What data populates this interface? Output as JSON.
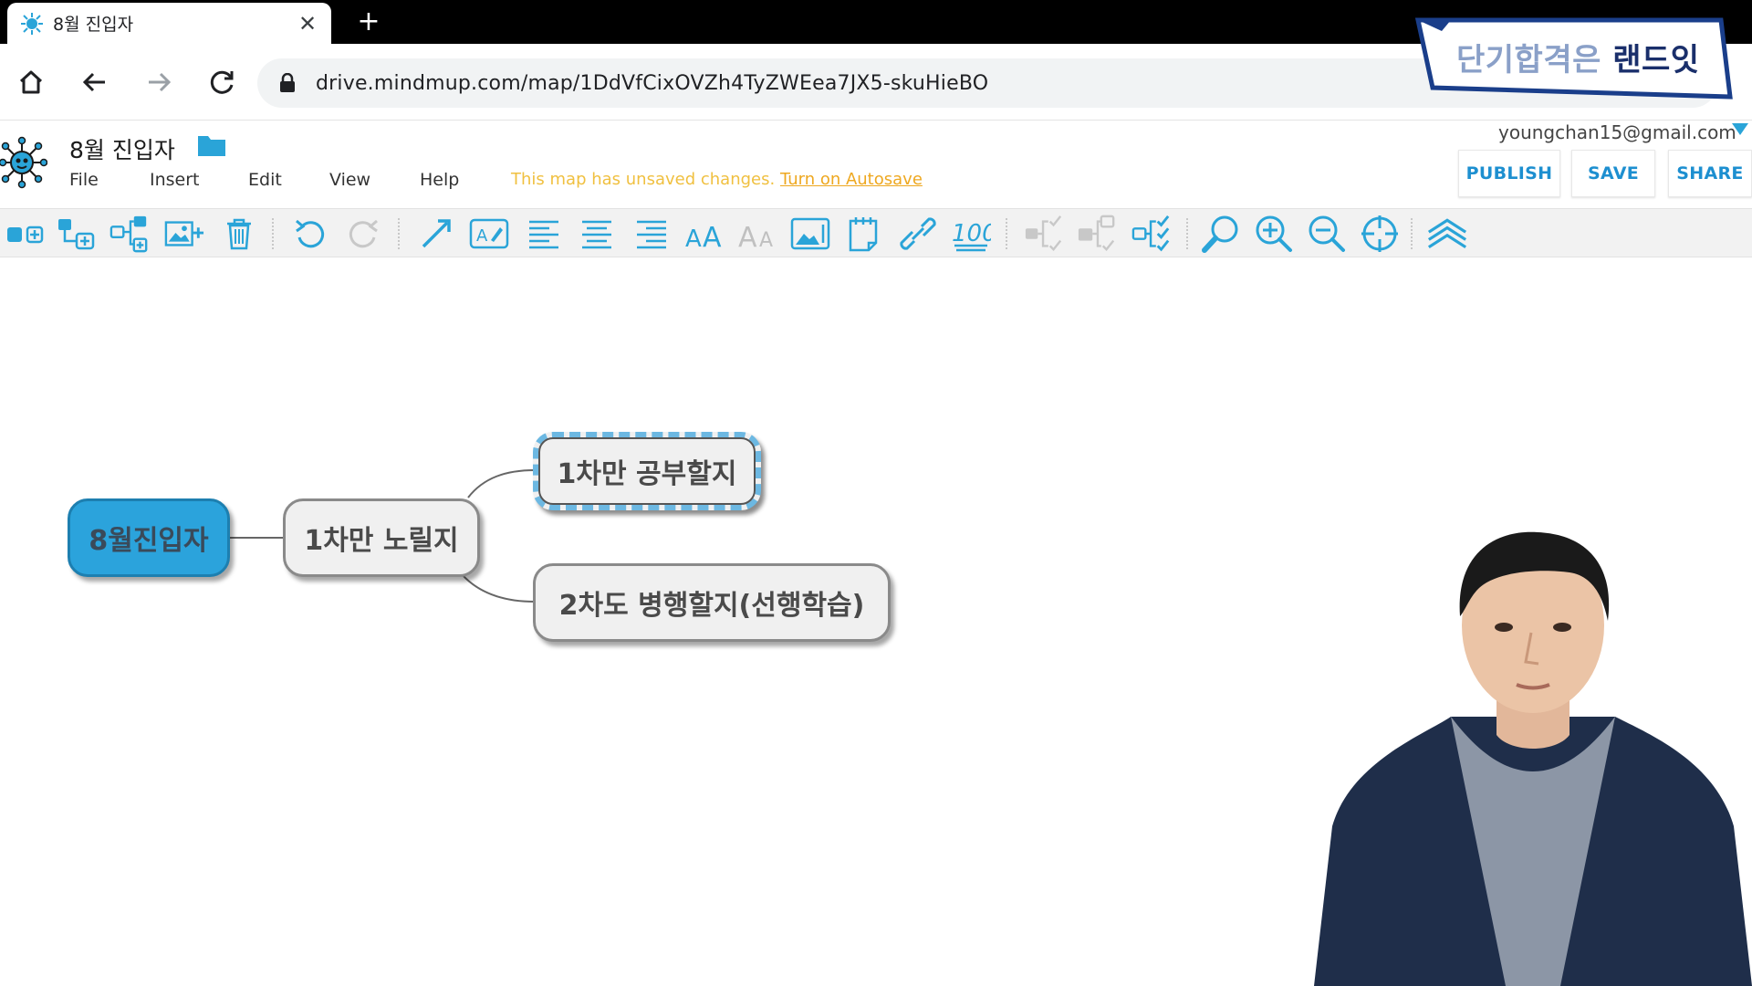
{
  "browser": {
    "tab_title": "8월 진입자",
    "url": "drive.mindmup.com/map/1DdVfCixOVZh4TyZWEea7JX5-skuHieBO"
  },
  "banner": {
    "light_text": "단기합격은",
    "bold_text": "랜드잇"
  },
  "app": {
    "map_title": "8월 진입자",
    "menu": [
      "File",
      "Insert",
      "Edit",
      "View",
      "Help"
    ],
    "unsaved_message": "This map has unsaved changes.",
    "autosave_link": "Turn on Autosave",
    "user_email": "youngchan15@gmail.com",
    "buttons": {
      "publish": "PUBLISH",
      "save": "SAVE",
      "share": "SHARE"
    },
    "accent_color": "#2ba3dc"
  },
  "toolbar_icons": [
    "add-sibling-icon",
    "add-child-icon",
    "insert-root-icon",
    "add-image-icon",
    "delete-icon",
    "undo-icon",
    "redo-icon",
    "connect-icon",
    "edit-text-icon",
    "align-left-icon",
    "align-center-icon",
    "align-right-icon",
    "font-size-up-icon",
    "font-size-down-icon",
    "image-icon",
    "note-icon",
    "link-icon",
    "progress-icon",
    "collapse-icon",
    "expand-icon",
    "select-subtree-icon",
    "search-icon",
    "zoom-in-icon",
    "zoom-out-icon",
    "reset-view-icon",
    "layers-up-icon"
  ],
  "mindmap": {
    "root": "8월진입자",
    "child": "1차만 노릴지",
    "grandchildren": [
      "1차만 공부할지",
      "2차도 병행할지(선행학습)"
    ],
    "selected": "1차만 공부할지"
  }
}
